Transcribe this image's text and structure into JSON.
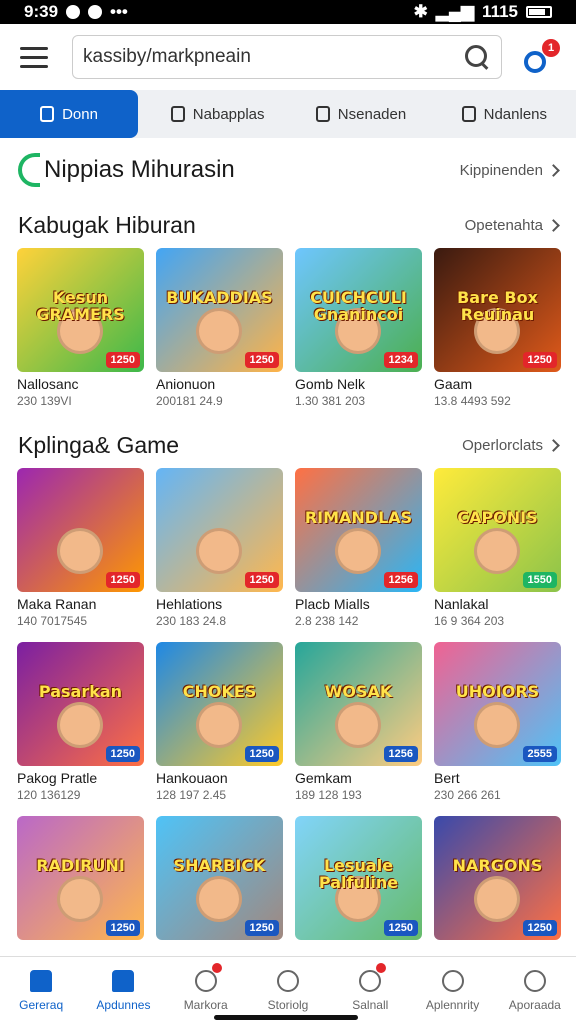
{
  "status": {
    "time": "9:39",
    "battery": "1115"
  },
  "search": {
    "value": "kassiby/markpneain"
  },
  "notification_count": "1",
  "tabs": [
    {
      "label": "Donn",
      "active": true
    },
    {
      "label": "Nabapplas"
    },
    {
      "label": "Nsenaden"
    },
    {
      "label": "Ndanlens"
    }
  ],
  "hero": {
    "title": "Nippias Mihurasin",
    "link": "Kippinenden"
  },
  "sections": [
    {
      "title": "Kabugak Hiburan",
      "link": "Opetenahta",
      "rows": [
        [
          {
            "art": "Kesun GRAMERS",
            "title": "Nallosanc",
            "meta": "230 139VI",
            "price": "1250",
            "bg": "linear-gradient(135deg,#ffd23a,#3db84a)",
            "badge": "red"
          },
          {
            "art": "BUKADDIAS",
            "title": "Anionuon",
            "meta": "200181 24.9",
            "price": "1250",
            "bg": "linear-gradient(135deg,#42a5f5,#ffb347)",
            "badge": "red"
          },
          {
            "art": "CUICHCULI Gnanincoi",
            "title": "Gomb Nelk",
            "meta": "1.30 381 203",
            "price": "1234",
            "bg": "linear-gradient(135deg,#6ec6ff,#4caf50)",
            "badge": "red"
          },
          {
            "art": "Bare Box Reuinau",
            "title": "Gaam",
            "meta": "13.8 4493 592",
            "price": "1250",
            "bg": "linear-gradient(135deg,#3a1a10,#e05a1a)",
            "badge": "red"
          }
        ]
      ]
    },
    {
      "title": "Kplinga& Game",
      "link": "Operlorclats",
      "rows": [
        [
          {
            "art": "",
            "title": "Maka Ranan",
            "meta": "140 7017545",
            "price": "1250",
            "bg": "linear-gradient(135deg,#9c27b0,#ff9800)",
            "badge": "red"
          },
          {
            "art": "",
            "title": "Hehlations",
            "meta": "230 183 24.8",
            "price": "1250",
            "bg": "linear-gradient(135deg,#64b5f6,#ffb74d)",
            "badge": "red"
          },
          {
            "art": "RIMANDLAS",
            "title": "Placb Mialls",
            "meta": "2.8 238 142",
            "price": "1256",
            "bg": "linear-gradient(135deg,#ff7043,#29b6f6)",
            "badge": "red"
          },
          {
            "art": "CAPONIS",
            "title": "Nanlakal",
            "meta": "16 9 364 203",
            "price": "1550",
            "bg": "linear-gradient(135deg,#ffeb3b,#8bc34a)",
            "badge": "green"
          }
        ],
        [
          {
            "art": "Pasarkan",
            "title": "Pakog Pratle",
            "meta": "120 136129",
            "price": "1250",
            "bg": "linear-gradient(135deg,#7b1fa2,#ff7043)",
            "badge": "blue"
          },
          {
            "art": "CHOKES",
            "title": "Hankouaon",
            "meta": "128 197 2.45",
            "price": "1250",
            "bg": "linear-gradient(135deg,#1e88e5,#ffca28)",
            "badge": "blue"
          },
          {
            "art": "WOSAK",
            "title": "Gemkam",
            "meta": "189 128 193",
            "price": "1256",
            "bg": "linear-gradient(135deg,#26a69a,#ffcc80)",
            "badge": "blue"
          },
          {
            "art": "UHOIORS",
            "title": "Bert",
            "meta": "230 266 261",
            "price": "2555",
            "bg": "linear-gradient(135deg,#f06292,#4fc3f7)",
            "badge": "blue"
          }
        ],
        [
          {
            "art": "RADIRUNI",
            "title": "",
            "meta": "",
            "price": "1250",
            "bg": "linear-gradient(135deg,#ba68c8,#ffb74d)",
            "badge": "blue"
          },
          {
            "art": "SHARBICK",
            "title": "",
            "meta": "",
            "price": "1250",
            "bg": "linear-gradient(135deg,#4fc3f7,#a1887f)",
            "badge": "blue"
          },
          {
            "art": "Lesuale Palfuline",
            "title": "",
            "meta": "",
            "price": "1250",
            "bg": "linear-gradient(135deg,#81d4fa,#66bb6a)",
            "badge": "blue"
          },
          {
            "art": "NARGONS",
            "title": "",
            "meta": "",
            "price": "1250",
            "bg": "linear-gradient(135deg,#3949ab,#ff7043)",
            "badge": "blue"
          }
        ]
      ]
    }
  ],
  "bottom_nav": [
    {
      "label": "Gereraq",
      "active": true
    },
    {
      "label": "Apdunnes",
      "active": true
    },
    {
      "label": "Markora",
      "badge": true
    },
    {
      "label": "Storiolg"
    },
    {
      "label": "Salnall",
      "badge": true
    },
    {
      "label": "Aplennrity"
    },
    {
      "label": "Aporaada"
    }
  ]
}
